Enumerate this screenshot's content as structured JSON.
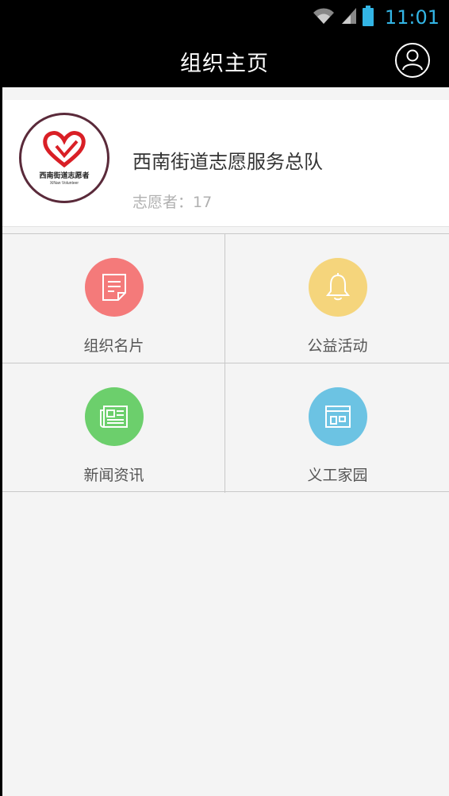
{
  "status_bar": {
    "time": "11:01",
    "accent": "#33b5e5"
  },
  "app_bar": {
    "title": "组织主页",
    "profile_icon": "user-profile-icon"
  },
  "org": {
    "name": "西南街道志愿服务总队",
    "volunteers_label": "志愿者：17",
    "logo": {
      "text_cn": "西南街道志愿者",
      "text_en": "XiNan Volunteer"
    }
  },
  "grid": {
    "items": [
      {
        "label": "组织名片",
        "icon": "card-icon",
        "color": "#f47a7a"
      },
      {
        "label": "公益活动",
        "icon": "bell-icon",
        "color": "#f5d57c"
      },
      {
        "label": "新闻资讯",
        "icon": "newspaper-icon",
        "color": "#6ccf6c"
      },
      {
        "label": "义工家园",
        "icon": "home-icon",
        "color": "#6cc3e3"
      }
    ]
  }
}
